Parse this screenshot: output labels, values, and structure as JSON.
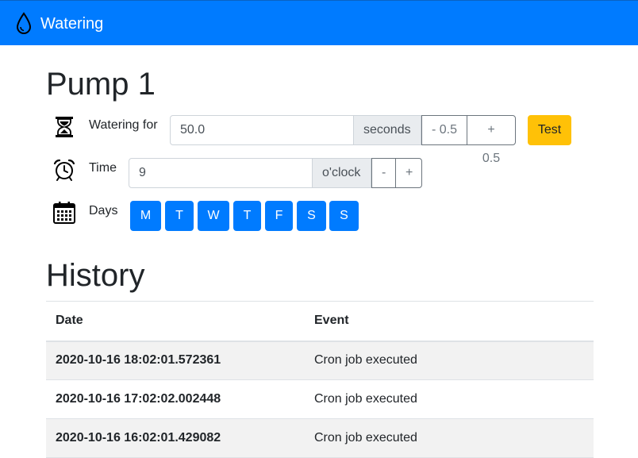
{
  "navbar": {
    "brand": "Watering",
    "icon": "water-drop-icon"
  },
  "pump": {
    "title": "Pump 1",
    "watering": {
      "label": "Watering for",
      "value": "50.0",
      "unit": "seconds",
      "decrement": "- 0.5",
      "increment": "+ 0.5",
      "test": "Test",
      "icon": "hourglass-icon"
    },
    "time": {
      "label": "Time",
      "value": "9",
      "unit": "o'clock",
      "decrement": "-",
      "increment": "+",
      "icon": "alarm-clock-icon"
    },
    "days": {
      "label": "Days",
      "icon": "calendar-icon",
      "items": [
        "M",
        "T",
        "W",
        "T",
        "F",
        "S",
        "S"
      ]
    }
  },
  "history": {
    "title": "History",
    "columns": [
      "Date",
      "Event"
    ],
    "rows": [
      {
        "date": "2020-10-16 18:02:01.572361",
        "event": "Cron job executed"
      },
      {
        "date": "2020-10-16 17:02:02.002448",
        "event": "Cron job executed"
      },
      {
        "date": "2020-10-16 16:02:01.429082",
        "event": "Cron job executed"
      }
    ]
  },
  "colors": {
    "primary": "#007bff",
    "warning": "#ffc107",
    "secondary": "#6c757d"
  }
}
